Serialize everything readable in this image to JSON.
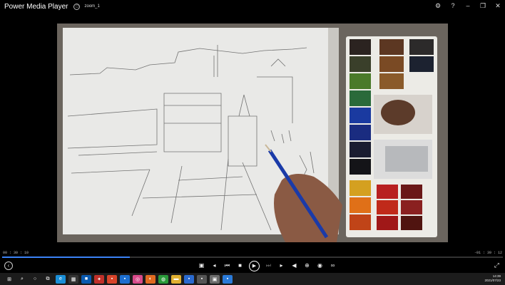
{
  "titlebar": {
    "app_title": "Power Media Player",
    "file_name": "zoom_1",
    "file_icon": "document-icon",
    "controls": [
      "settings-icon",
      "help-icon",
      "minimize-icon",
      "restore-icon",
      "close-icon"
    ]
  },
  "player": {
    "elapsed": "00 : 30 : 10",
    "remaining": "-01 : 39 : 12",
    "progress_fraction": 0.255,
    "accent_color": "#3b82f6"
  },
  "controls": [
    "back-icon",
    "screenshot-icon",
    "prev-icon",
    "rewind-icon",
    "stop-icon",
    "play-icon",
    "skip-icon",
    "next-icon",
    "volume-icon",
    "zoom-icon",
    "eye-icon",
    "link-icon",
    "fullscreen-icon"
  ],
  "taskbar": {
    "items": [
      "windows-icon",
      "search-icon",
      "cortana-icon",
      "taskview-icon",
      "edge-icon",
      "store-icon",
      "app-icon",
      "app-icon",
      "app-icon",
      "app-icon",
      "app-icon",
      "firefox-icon",
      "chrome-icon",
      "explorer-icon",
      "app-icon",
      "app-icon",
      "app-icon",
      "app-icon"
    ],
    "time": "14:39",
    "date": "2021/07/23"
  }
}
